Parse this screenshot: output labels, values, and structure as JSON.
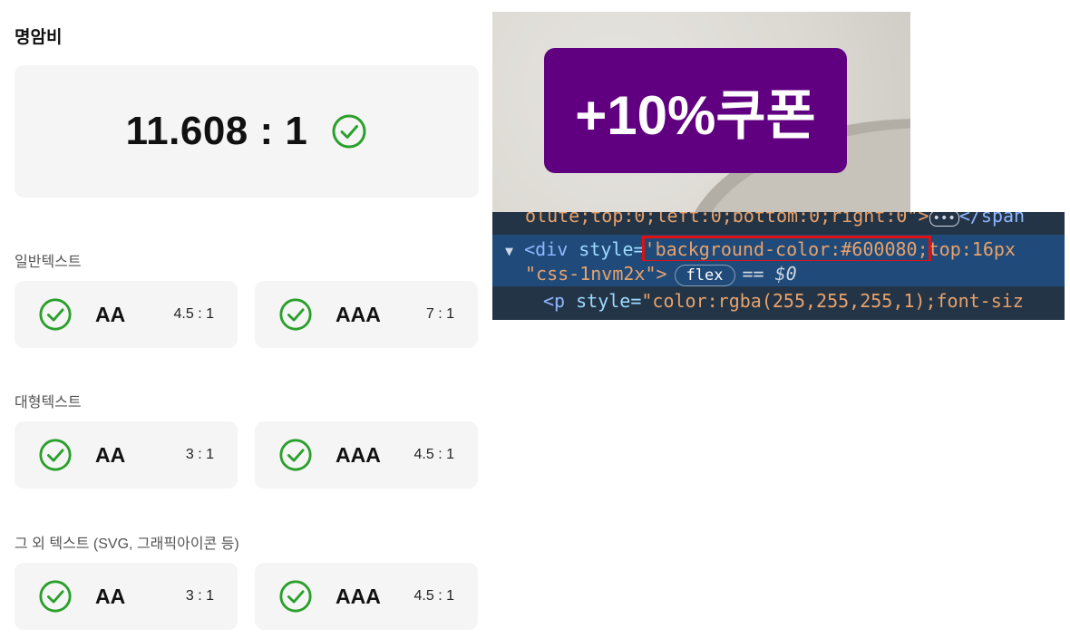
{
  "contrast": {
    "heading": "명암비",
    "ratio": "11.608 : 1",
    "sections": [
      {
        "label": "일반텍스트",
        "levels": [
          {
            "level": "AA",
            "required": "4.5 : 1"
          },
          {
            "level": "AAA",
            "required": "7 : 1"
          }
        ]
      },
      {
        "label": "대형텍스트",
        "levels": [
          {
            "level": "AA",
            "required": "3 : 1"
          },
          {
            "level": "AAA",
            "required": "4.5 : 1"
          }
        ]
      },
      {
        "label": "그 외 텍스트 (SVG, 그래픽아이콘 등)",
        "levels": [
          {
            "level": "AA",
            "required": "3 : 1"
          },
          {
            "level": "AAA",
            "required": "4.5 : 1"
          }
        ]
      }
    ],
    "pass_icon": "check-circle-icon",
    "pass_color": "#2aa02a"
  },
  "coupon": {
    "text": "+10%쿠폰",
    "background": "#600080"
  },
  "devtools": {
    "line1": "olute;top:0;left:0;bottom:0;right:0\">",
    "line1_end": "</span",
    "line2_tag": "<div ",
    "line2_attr": "style=",
    "line2_highlight": "'background-color:#600080;",
    "line2_rest": "top:16px",
    "line3_class": "\"css-1nvm2x\">",
    "line3_badge": "flex",
    "line3_eq": "== $0",
    "line4_tag": "<p ",
    "line4_attr": "style=",
    "line4_value": "\"color:rgba(255,255,255,1);font-siz",
    "highlight_color": "#e01010"
  }
}
